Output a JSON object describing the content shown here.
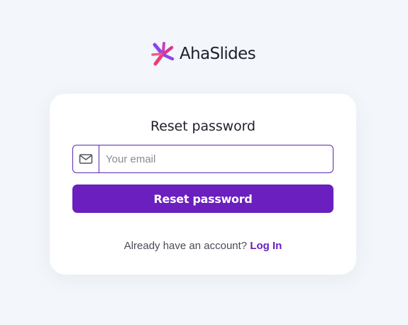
{
  "brand": {
    "name": "AhaSlides",
    "logo_icon": "ahaslides-burst-logo"
  },
  "reset_form": {
    "title": "Reset password",
    "email_field": {
      "icon": "mail-icon",
      "placeholder": "Your email",
      "value": ""
    },
    "submit_label": "Reset password",
    "footer_prompt": "Already have an account?",
    "login_link_label": "Log In"
  },
  "colors": {
    "accent": "#6a1fbe",
    "background": "#f3f6fa",
    "card": "#ffffff",
    "logo_pink": "#e6348a",
    "logo_purple": "#7b3fe4"
  }
}
